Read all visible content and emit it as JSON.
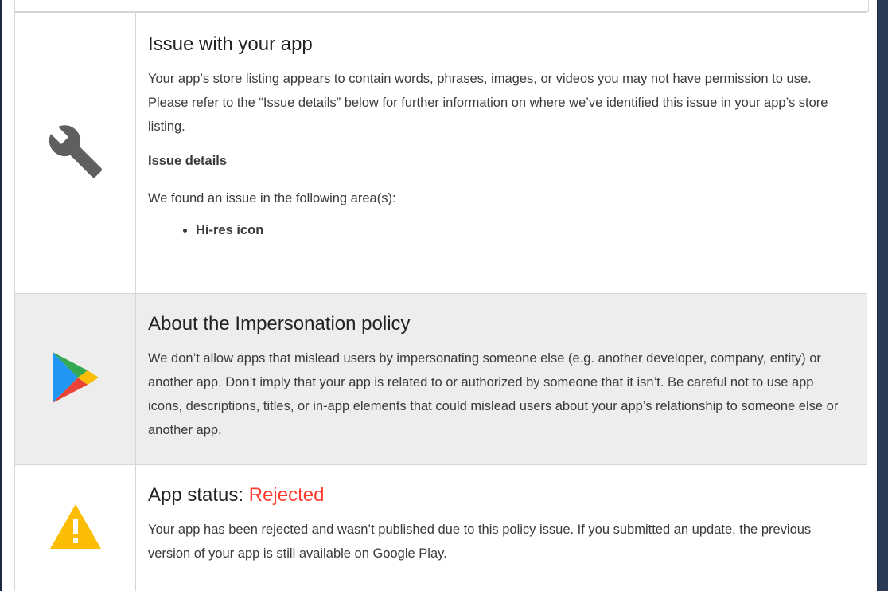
{
  "issue": {
    "title": "Issue with your app",
    "body": "Your app’s store listing appears to contain words, phrases, images, or videos you may not have permission to use. Please refer to the “Issue details” below for further information on where we’ve identified this issue in your app’s store listing.",
    "details_heading": "Issue details",
    "found_text": "We found an issue in the following area(s):",
    "areas": [
      "Hi-res icon"
    ],
    "icon": "wrench-icon"
  },
  "policy": {
    "title": "About the Impersonation policy",
    "body": "We don’t allow apps that mislead users by impersonating someone else (e.g. another developer, company, entity) or another app. Don’t imply that your app is related to or authorized by someone that it isn’t. Be careful not to use app icons, descriptions, titles, or in-app elements that could mislead users about your app’s relationship to someone else or another app.",
    "icon": "google-play-icon"
  },
  "status": {
    "label": "App status: ",
    "value": "Rejected",
    "value_color": "#ff3b30",
    "body": "Your app has been rejected and wasn’t published due to this policy issue. If you submitted an update, the previous version of your app is still available on Google Play.",
    "icon": "warning-icon"
  },
  "colors": {
    "warning": "#fbbc04",
    "row_highlight": "#ededed",
    "border": "#d6d6d6"
  }
}
